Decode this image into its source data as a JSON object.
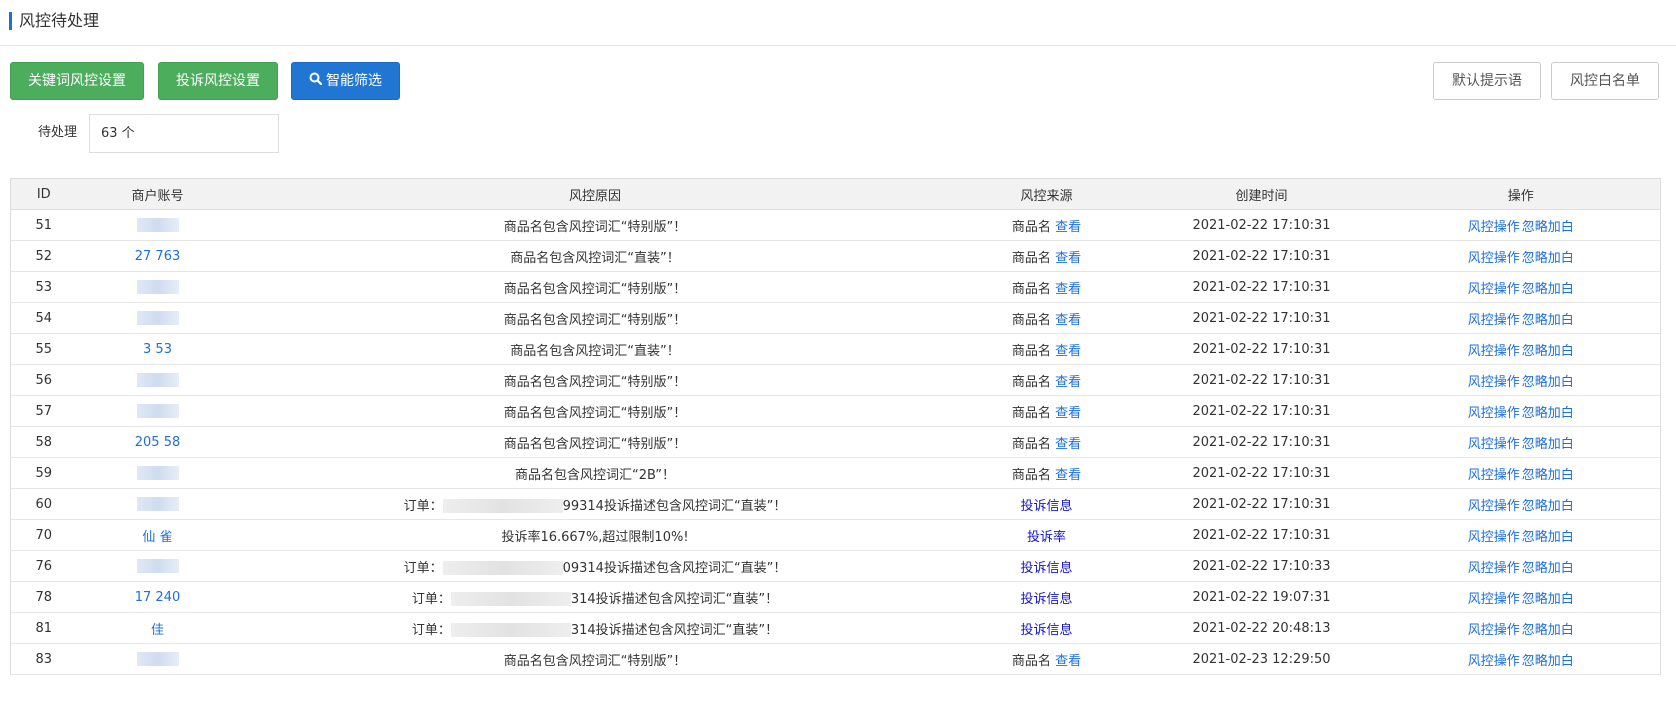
{
  "header": {
    "title": "风控待处理"
  },
  "toolbar": {
    "keyword_btn": "关键词风控设置",
    "complaint_btn": "投诉风控设置",
    "smart_filter_btn": "智能筛选",
    "default_tip_btn": "默认提示语",
    "whitelist_btn": "风控白名单"
  },
  "filter": {
    "label": "待处理",
    "value": "63 个"
  },
  "colors": {
    "green": "#4cad5d",
    "blue": "#2176d4",
    "link": "#1e6fd9"
  },
  "icons": {
    "smart_filter": "search-icon"
  },
  "table": {
    "headers": [
      "ID",
      "商户账号",
      "风控原因",
      "风控来源",
      "创建时间",
      "操作"
    ],
    "rows": [
      {
        "id": "51",
        "account": "",
        "reason": "商品名包含风控词汇“特别版”！",
        "source": "商品名",
        "source_link": "查看",
        "time": "2021-02-22 17:10:31"
      },
      {
        "id": "52",
        "account": "27 763",
        "reason": "商品名包含风控词汇“直装”！",
        "source": "商品名",
        "source_link": "查看",
        "time": "2021-02-22 17:10:31"
      },
      {
        "id": "53",
        "account": "",
        "reason": "商品名包含风控词汇“特别版”！",
        "source": "商品名",
        "source_link": "查看",
        "time": "2021-02-22 17:10:31"
      },
      {
        "id": "54",
        "account": "",
        "reason": "商品名包含风控词汇“特别版”！",
        "source": "商品名",
        "source_link": "查看",
        "time": "2021-02-22 17:10:31"
      },
      {
        "id": "55",
        "account": "3 53",
        "reason": "商品名包含风控词汇“直装”！",
        "source": "商品名",
        "source_link": "查看",
        "time": "2021-02-22 17:10:31"
      },
      {
        "id": "56",
        "account": "",
        "reason": "商品名包含风控词汇“特别版”！",
        "source": "商品名",
        "source_link": "查看",
        "time": "2021-02-22 17:10:31"
      },
      {
        "id": "57",
        "account": "",
        "reason": "商品名包含风控词汇“特别版”！",
        "source": "商品名",
        "source_link": "查看",
        "time": "2021-02-22 17:10:31"
      },
      {
        "id": "58",
        "account": "205 58",
        "reason": "商品名包含风控词汇“特别版”！",
        "source": "商品名",
        "source_link": "查看",
        "time": "2021-02-22 17:10:31"
      },
      {
        "id": "59",
        "account": "",
        "reason": "商品名包含风控词汇“2B”！",
        "source": "商品名",
        "source_link": "查看",
        "time": "2021-02-22 17:10:31"
      },
      {
        "id": "60",
        "account": "",
        "reason_prefix": "订单：",
        "reason_suffix": "99314投诉描述包含风控词汇“直装”！",
        "source_link": "投诉信息",
        "time": "2021-02-22 17:10:31"
      },
      {
        "id": "70",
        "account": "仙 雀",
        "reason": "投诉率16.667%,超过限制10%!",
        "source_link": "投诉率",
        "time": "2021-02-22 17:10:31"
      },
      {
        "id": "76",
        "account": "",
        "reason_prefix": "订单：",
        "reason_suffix": "09314投诉描述包含风控词汇“直装”！",
        "source_link": "投诉信息",
        "time": "2021-02-22 17:10:33"
      },
      {
        "id": "78",
        "account": "17 240",
        "reason_prefix": "订单：",
        "reason_suffix": "314投诉描述包含风控词汇“直装”！",
        "source_link": "投诉信息",
        "time": "2021-02-22 19:07:31"
      },
      {
        "id": "81",
        "account": "佳",
        "reason_prefix": "订单：",
        "reason_suffix": "314投诉描述包含风控词汇“直装”！",
        "source_link": "投诉信息",
        "time": "2021-02-22 20:48:13"
      },
      {
        "id": "83",
        "account": "",
        "reason": "商品名包含风控词汇“特别版”！",
        "source": "商品名",
        "source_link": "查看",
        "time": "2021-02-23 12:29:50"
      }
    ],
    "op_risk": "风控操作",
    "op_ignore": "忽略加白"
  }
}
